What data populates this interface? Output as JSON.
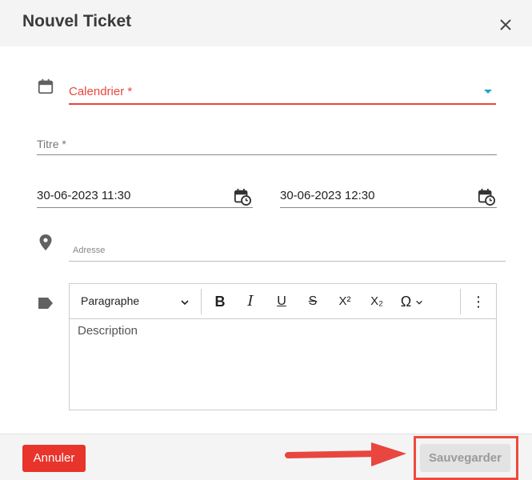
{
  "dialog": {
    "title": "Nouvel Ticket"
  },
  "form": {
    "calendar_label": "Calendrier *",
    "title_label": "Titre *",
    "start_date": "30-06-2023 11:30",
    "end_date": "30-06-2023 12:30",
    "address_placeholder": "Adresse",
    "description_placeholder": "Description"
  },
  "editor_toolbar": {
    "paragraph_label": "Paragraphe",
    "bold": "B",
    "italic": "I",
    "underline": "U",
    "strikethrough": "S",
    "superscript": "X²",
    "subscript": "X₂",
    "special_chars": "Ω",
    "more": "⋮"
  },
  "footer": {
    "cancel_label": "Annuler",
    "save_label": "Sauvegarder"
  },
  "colors": {
    "error": "#e8463e",
    "cancel_bg": "#e8342b",
    "highlight": "#ee4a3e",
    "dropdown_caret": "#2a9fc8"
  },
  "icons": {
    "close": "close-icon",
    "calendar": "calendar-icon",
    "date_picker": "calendar-clock-icon",
    "location": "map-pin-icon",
    "label": "tag-icon"
  }
}
